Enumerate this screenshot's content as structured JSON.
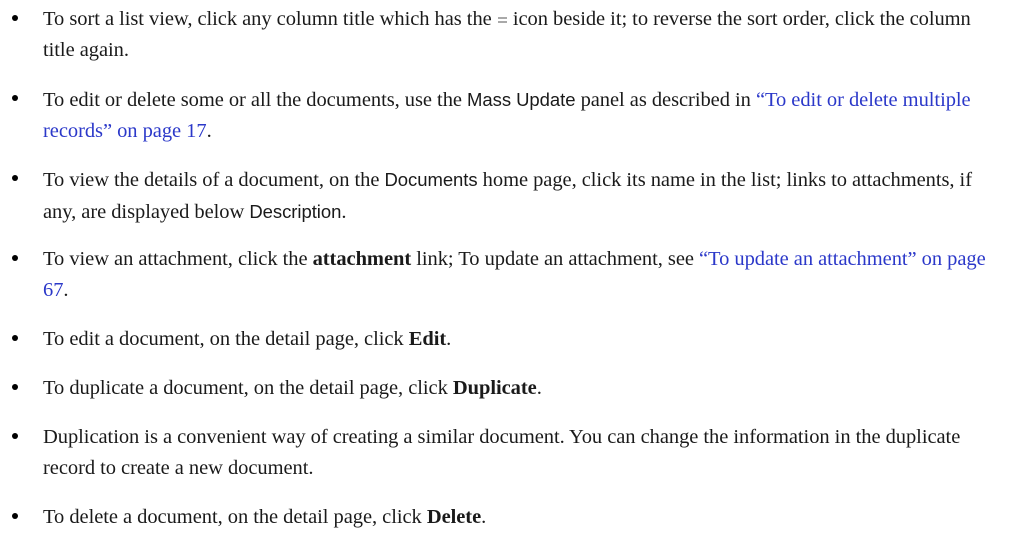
{
  "items": [
    {
      "pre": "To sort a list view, click any column title which has the",
      "icon": "sort-icon",
      "post": "icon beside it; to reverse the sort order, click the column title again."
    },
    {
      "pre": "To edit or delete some or all the documents, use the",
      "ui_term": "Mass Update",
      "mid": "panel as described in",
      "link": "“To edit or delete multiple records” on page 17",
      "post": "."
    },
    {
      "pre": "To view the details of a document, on the",
      "ui_term": "Documents",
      "mid": "home page, click its name in the list; links to attachments, if any, are displayed below",
      "ui_term2": "Description",
      "post": "."
    },
    {
      "pre": "To view an attachment, click the",
      "bold": "attachment",
      "mid": "link; To update an attachment, see",
      "link": "“To update an attachment” on page 67",
      "post": "."
    },
    {
      "pre": "To edit a document, on the detail page, click",
      "bold": "Edit",
      "post": "."
    },
    {
      "pre": "To duplicate a document, on the detail page, click",
      "bold": "Duplicate",
      "post": "."
    },
    {
      "pre": "Duplication is a convenient way of creating a similar document. You can change the information in the duplicate record to create a new document."
    },
    {
      "pre": "To delete a document, on the detail page, click",
      "bold": "Delete",
      "post": "."
    }
  ]
}
